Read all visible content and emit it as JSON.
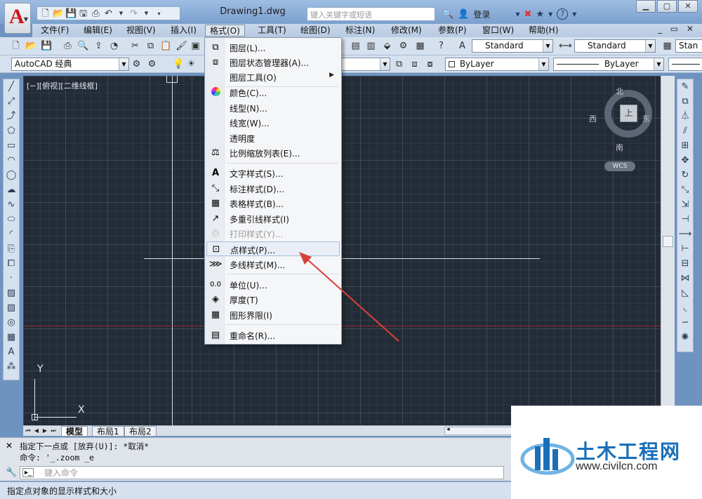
{
  "app": {
    "title": "Drawing1.dwg",
    "search_placeholder": "键入关键字或短语",
    "login": "登录",
    "logo_letter": "A"
  },
  "menubar": [
    {
      "label": "文件(F)"
    },
    {
      "label": "编辑(E)"
    },
    {
      "label": "视图(V)"
    },
    {
      "label": "插入(I)"
    },
    {
      "label": "格式(O)"
    },
    {
      "label": "工具(T)"
    },
    {
      "label": "绘图(D)"
    },
    {
      "label": "标注(N)"
    },
    {
      "label": "修改(M)"
    },
    {
      "label": "参数(P)"
    },
    {
      "label": "窗口(W)"
    },
    {
      "label": "帮助(H)"
    }
  ],
  "toolbar": {
    "text_style": "Standard",
    "dim_style": "Standard",
    "table_style": "Stan",
    "workspace": "AutoCAD 经典",
    "color": "ByLayer",
    "linetype": "ByLayer"
  },
  "format_menu": {
    "items": [
      {
        "label": "图层(L)...",
        "icon": "layer-icon"
      },
      {
        "label": "图层状态管理器(A)...",
        "icon": "layer-state-icon"
      },
      {
        "label": "图层工具(O)",
        "icon": ""
      },
      {
        "label": "颜色(C)...",
        "icon": "color-wheel-icon"
      },
      {
        "label": "线型(N)...",
        "icon": ""
      },
      {
        "label": "线宽(W)...",
        "icon": ""
      },
      {
        "label": "透明度",
        "icon": ""
      },
      {
        "label": "比例缩放列表(E)...",
        "icon": "scale-list-icon"
      },
      {
        "label": "文字样式(S)...",
        "icon": "text-style-icon"
      },
      {
        "label": "标注样式(D)...",
        "icon": "dim-style-icon"
      },
      {
        "label": "表格样式(B)...",
        "icon": "table-style-icon"
      },
      {
        "label": "多重引线样式(I)",
        "icon": "mleader-style-icon"
      },
      {
        "label": "打印样式(Y)...",
        "icon": "plot-style-icon"
      },
      {
        "label": "点样式(P)...",
        "icon": "point-style-icon"
      },
      {
        "label": "多线样式(M)...",
        "icon": "mline-style-icon"
      },
      {
        "label": "单位(U)...",
        "icon": "units-icon"
      },
      {
        "label": "厚度(T)",
        "icon": "thickness-icon"
      },
      {
        "label": "图形界限(I)",
        "icon": "limits-icon"
      },
      {
        "label": "重命名(R)...",
        "icon": "rename-icon"
      }
    ]
  },
  "viewport": {
    "label": "[−][俯视][二维线框]"
  },
  "viewcube": {
    "north": "北",
    "south": "南",
    "east": "东",
    "west": "西",
    "face": "上",
    "wcs": "WCS"
  },
  "ucs": {
    "x": "X",
    "y": "Y"
  },
  "layout_tabs": [
    {
      "label": "模型",
      "active": true
    },
    {
      "label": "布局1",
      "active": false
    },
    {
      "label": "布局2",
      "active": false
    }
  ],
  "command": {
    "line1": "指定下一点或 [放弃(U)]: *取消*",
    "line2": "命令: '_.zoom _e",
    "prompt": "键入命令"
  },
  "status": {
    "text": "指定点对象的显示样式和大小"
  },
  "watermark": {
    "brand": "土木工程网",
    "url": "www.civilcn.com"
  },
  "colors": {
    "canvas": "#232b36",
    "accent_arrow": "#d9403a",
    "title_bar": "#7aa0cf"
  }
}
